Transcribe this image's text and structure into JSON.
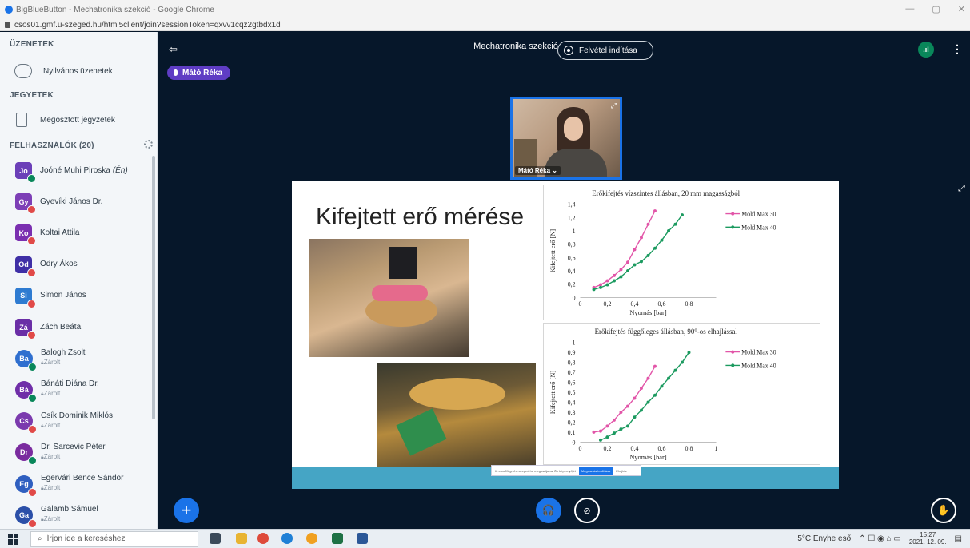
{
  "browser": {
    "window_title": "BigBlueButton - Mechatronika szekció - Google Chrome",
    "url": "csos01.gmf.u-szeged.hu/html5client/join?sessionToken=qxvv1cqz2gtbdx1d"
  },
  "sidebar": {
    "messages_heading": "ÜZENETEK",
    "public_chat": "Nyilvános üzenetek",
    "notes_heading": "JEGYETEK",
    "shared_notes": "Megosztott jegyzetek",
    "users_heading": "FELHASZNÁLÓK (20)",
    "users": [
      {
        "initials": "Jo",
        "name": "Joóné Muhi Piroska",
        "suffix": "(Én)",
        "sub": "",
        "color": "#6b3fb8",
        "shape": "square",
        "status": "on"
      },
      {
        "initials": "Gy",
        "name": "Gyevíki János Dr.",
        "suffix": "",
        "sub": "",
        "color": "#7d3fb6",
        "shape": "square",
        "status": "off"
      },
      {
        "initials": "Ko",
        "name": "Koltai Attila",
        "suffix": "",
        "sub": "",
        "color": "#7a2fb0",
        "shape": "square",
        "status": "off"
      },
      {
        "initials": "Od",
        "name": "Odry Ákos",
        "suffix": "",
        "sub": "",
        "color": "#3f2fa6",
        "shape": "square",
        "status": "off"
      },
      {
        "initials": "Si",
        "name": "Simon János",
        "suffix": "",
        "sub": "",
        "color": "#2e7bd1",
        "shape": "square",
        "status": "off"
      },
      {
        "initials": "Zá",
        "name": "Zách Beáta",
        "suffix": "",
        "sub": "",
        "color": "#6a2ea6",
        "shape": "square",
        "status": "off"
      },
      {
        "initials": "Ba",
        "name": "Balogh Zsolt",
        "suffix": "",
        "sub": "Zárolt",
        "color": "#2f6fcf",
        "shape": "round",
        "status": "on"
      },
      {
        "initials": "Bá",
        "name": "Bánáti Diána Dr.",
        "suffix": "",
        "sub": "Zárolt",
        "color": "#6f2ea8",
        "shape": "round",
        "status": "on"
      },
      {
        "initials": "Cs",
        "name": "Csík Dominik Miklós",
        "suffix": "",
        "sub": "Zárolt",
        "color": "#7b3aae",
        "shape": "round",
        "status": "off"
      },
      {
        "initials": "Dr",
        "name": "Dr. Sarcevic Péter",
        "suffix": "",
        "sub": "Zárolt",
        "color": "#7a2b9f",
        "shape": "round",
        "status": "on"
      },
      {
        "initials": "Eg",
        "name": "Egervári Bence Sándor",
        "suffix": "",
        "sub": "Zárolt",
        "color": "#2f5fc0",
        "shape": "round",
        "status": "off"
      },
      {
        "initials": "Ga",
        "name": "Galamb Sámuel",
        "suffix": "",
        "sub": "Zárolt",
        "color": "#2b4fa8",
        "shape": "round",
        "status": "off"
      }
    ]
  },
  "main": {
    "meeting_title": "Mechatronika szekció",
    "record_label": "Felvétel indítása",
    "talker_name": "Mátó Réka",
    "webcam_name": "Mátó Réka",
    "conn_icon": "signal-icon",
    "toast_text": "Itt csos01.gmf.u-szeged.hu megosztja az Ön képernyőjét",
    "toast_button": "Megosztás leállítása",
    "toast_hide": "Elrejtés"
  },
  "slide": {
    "title": "Kifejtett erő mérése"
  },
  "chart_data": [
    {
      "type": "line",
      "title": "Erőkifejtés vízszintes állásban, 20 mm magasságból",
      "xlabel": "Nyomás [bar]",
      "ylabel": "Kifejtett erő [N]",
      "xlim": [
        0,
        1
      ],
      "ylim": [
        0,
        1.4
      ],
      "xticks": [
        "0",
        "0,2",
        "0,4",
        "0,6",
        "0,8"
      ],
      "yticks": [
        "0",
        "0,2",
        "0,4",
        "0,6",
        "0,8",
        "1",
        "1,2",
        "1,4"
      ],
      "legend": "right",
      "series": [
        {
          "name": "Mold Max 30",
          "color": "#e255a8",
          "x": [
            0.1,
            0.15,
            0.2,
            0.25,
            0.3,
            0.35,
            0.4,
            0.45,
            0.5,
            0.55
          ],
          "y": [
            0.15,
            0.19,
            0.25,
            0.33,
            0.42,
            0.53,
            0.72,
            0.9,
            1.1,
            1.3
          ]
        },
        {
          "name": "Mold Max 40",
          "color": "#1b9a5f",
          "x": [
            0.1,
            0.15,
            0.2,
            0.25,
            0.3,
            0.35,
            0.4,
            0.45,
            0.5,
            0.55,
            0.6,
            0.65,
            0.7,
            0.75
          ],
          "y": [
            0.12,
            0.15,
            0.19,
            0.25,
            0.31,
            0.4,
            0.49,
            0.54,
            0.63,
            0.74,
            0.86,
            1.0,
            1.1,
            1.24
          ]
        }
      ]
    },
    {
      "type": "line",
      "title": "Erőkifejtés függőleges állásban, 90°-os elhajlással",
      "xlabel": "Nyomás [bar]",
      "ylabel": "Kifejtett erő [N]",
      "xlim": [
        0,
        1
      ],
      "ylim": [
        0,
        1
      ],
      "xticks": [
        "0",
        "0,2",
        "0,4",
        "0,6",
        "0,8",
        "1"
      ],
      "yticks": [
        "0",
        "0,1",
        "0,2",
        "0,3",
        "0,4",
        "0,5",
        "0,6",
        "0,7",
        "0,8",
        "0,9",
        "1"
      ],
      "legend": "right",
      "series": [
        {
          "name": "Mold Max 30",
          "color": "#e255a8",
          "x": [
            0.1,
            0.15,
            0.2,
            0.25,
            0.3,
            0.35,
            0.4,
            0.45,
            0.5,
            0.55
          ],
          "y": [
            0.1,
            0.11,
            0.16,
            0.22,
            0.3,
            0.36,
            0.44,
            0.54,
            0.64,
            0.76
          ]
        },
        {
          "name": "Mold Max 40",
          "color": "#1b9a5f",
          "x": [
            0.15,
            0.2,
            0.25,
            0.3,
            0.35,
            0.4,
            0.45,
            0.5,
            0.55,
            0.6,
            0.65,
            0.7,
            0.75,
            0.8
          ],
          "y": [
            0.02,
            0.05,
            0.09,
            0.13,
            0.16,
            0.25,
            0.32,
            0.4,
            0.47,
            0.56,
            0.64,
            0.72,
            0.8,
            0.9
          ]
        }
      ]
    }
  ],
  "taskbar": {
    "search_placeholder": "Írjon ide a kereséshez",
    "weather": "5°C  Enyhe eső",
    "time": "15:27",
    "date": "2021. 12. 09."
  }
}
